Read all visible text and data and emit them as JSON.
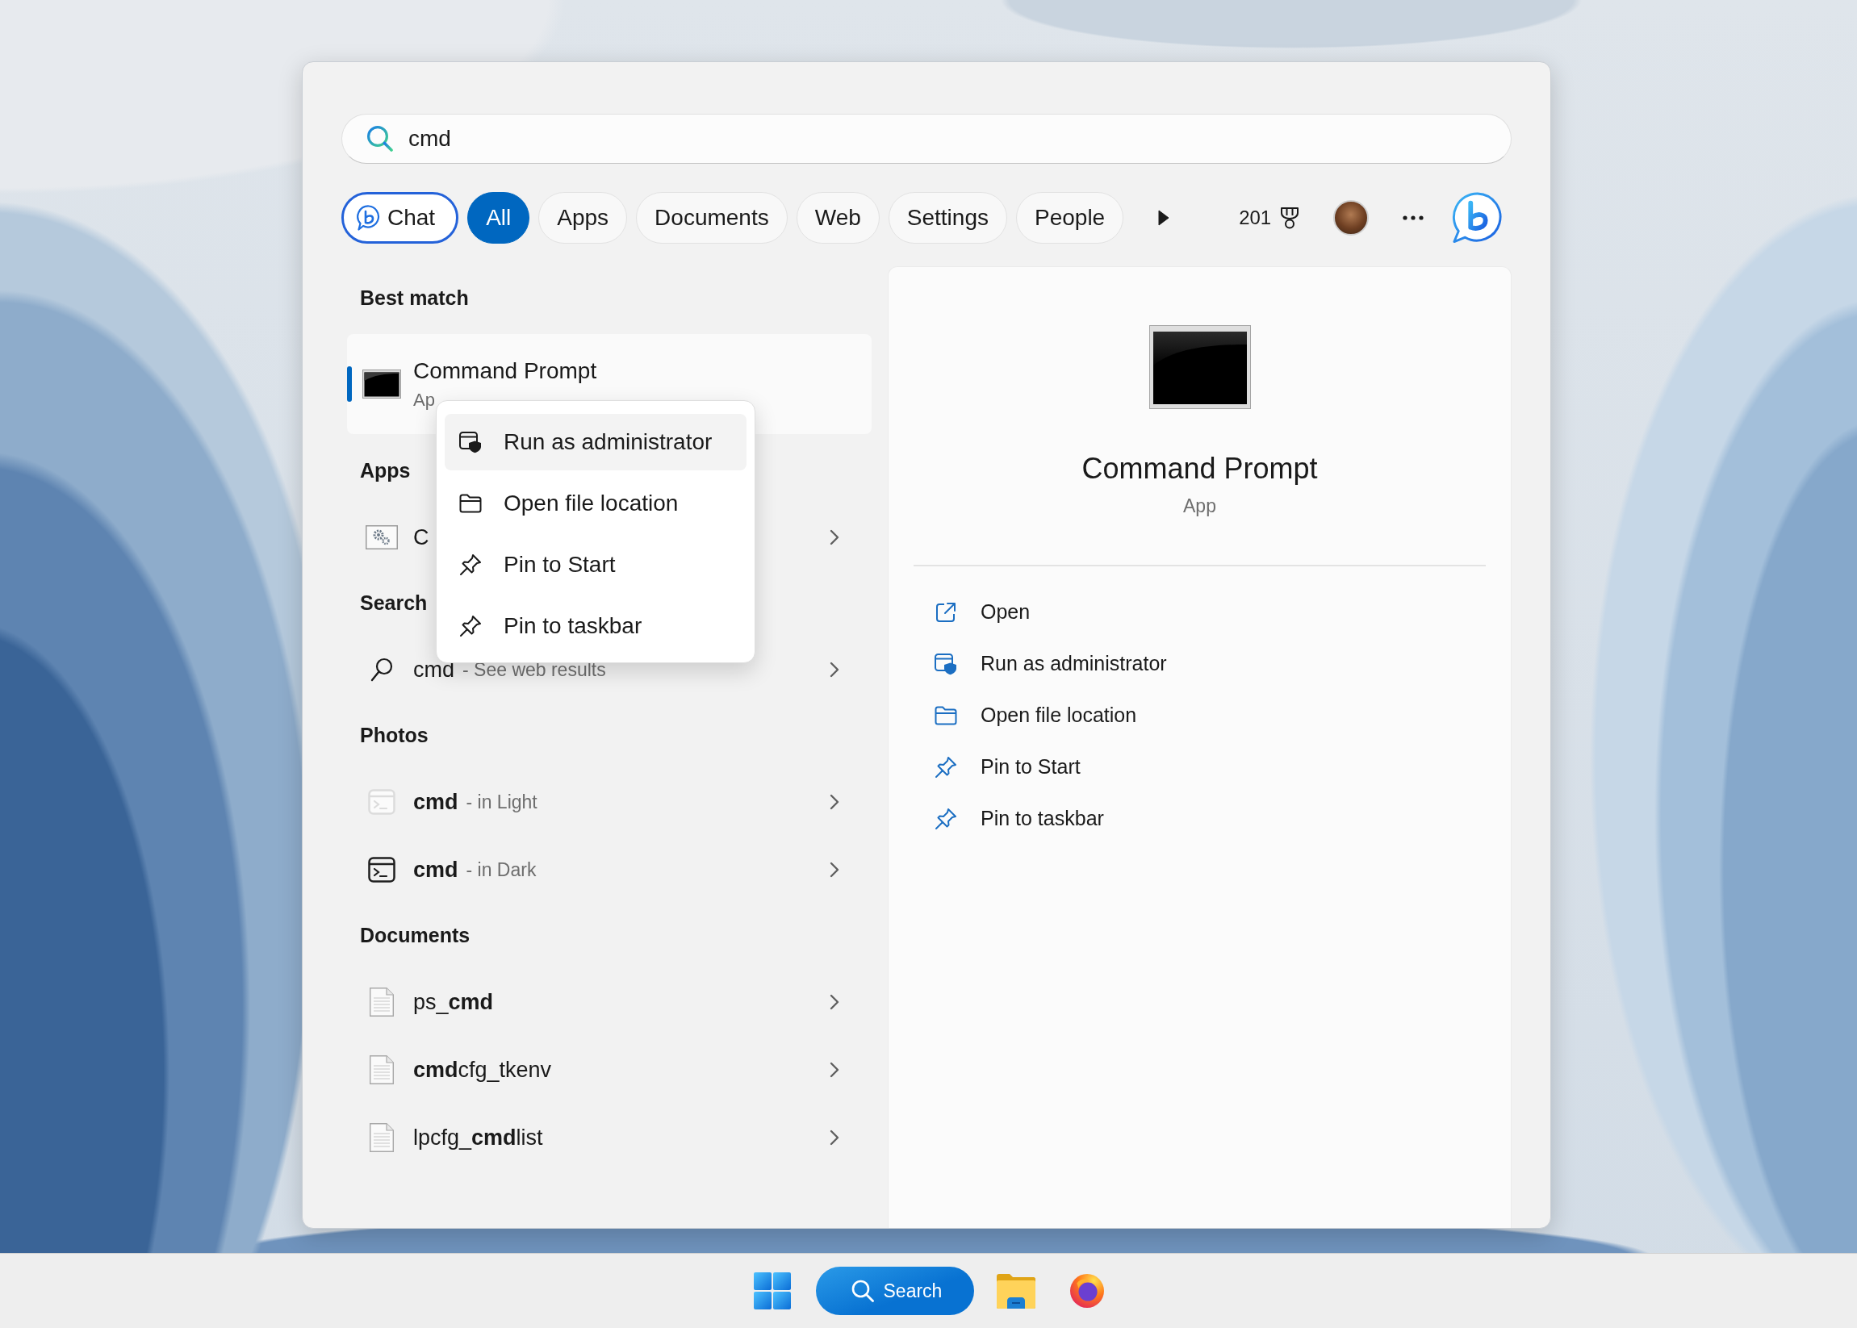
{
  "search_box": {
    "value": "cmd"
  },
  "filters": [
    {
      "label": "Chat",
      "kind": "chat",
      "selected": false
    },
    {
      "label": "All",
      "kind": "scope",
      "selected": true
    },
    {
      "label": "Apps",
      "kind": "scope",
      "selected": false
    },
    {
      "label": "Documents",
      "kind": "scope",
      "selected": false
    },
    {
      "label": "Web",
      "kind": "scope",
      "selected": false
    },
    {
      "label": "Settings",
      "kind": "scope",
      "selected": false
    },
    {
      "label": "People",
      "kind": "scope",
      "selected": false
    }
  ],
  "rewards": {
    "points": "201"
  },
  "best_match": {
    "heading": "Best match",
    "title": "Command Prompt",
    "subtitle": "Ap",
    "selected": true
  },
  "sections": [
    {
      "heading": "Apps",
      "items": [
        {
          "kind": "app",
          "title": "C"
        }
      ]
    },
    {
      "heading": "Search",
      "items": [
        {
          "kind": "web",
          "title": "cmd",
          "detail": "- See web results"
        }
      ]
    },
    {
      "heading": "Photos",
      "items": [
        {
          "kind": "lightphoto",
          "title": "cmd",
          "detail": "- in Light"
        },
        {
          "kind": "darkphoto",
          "title": "cmd",
          "detail": "- in Dark"
        }
      ]
    },
    {
      "heading": "Documents",
      "items": [
        {
          "kind": "document",
          "title": "ps_**cmd**"
        },
        {
          "kind": "document",
          "title": "**cmd**cfg_tkenv"
        },
        {
          "kind": "document",
          "title": "lpcfg_**cmd**list"
        }
      ]
    }
  ],
  "context_menu": {
    "items": [
      {
        "kind": "admin",
        "label": "Run as administrator",
        "selected": true
      },
      {
        "kind": "folder",
        "label": "Open file location",
        "selected": false
      },
      {
        "kind": "pin",
        "label": "Pin to Start",
        "selected": false
      },
      {
        "kind": "pin",
        "label": "Pin to taskbar",
        "selected": false
      }
    ]
  },
  "preview": {
    "title": "Command Prompt",
    "subtitle": "App",
    "actions": [
      {
        "kind": "open",
        "label": "Open"
      },
      {
        "kind": "admin",
        "label": "Run as administrator"
      },
      {
        "kind": "folder",
        "label": "Open file location"
      },
      {
        "kind": "pin",
        "label": "Pin to Start"
      },
      {
        "kind": "pin",
        "label": "Pin to taskbar"
      }
    ]
  },
  "taskbar": {
    "search_label": "Search"
  }
}
